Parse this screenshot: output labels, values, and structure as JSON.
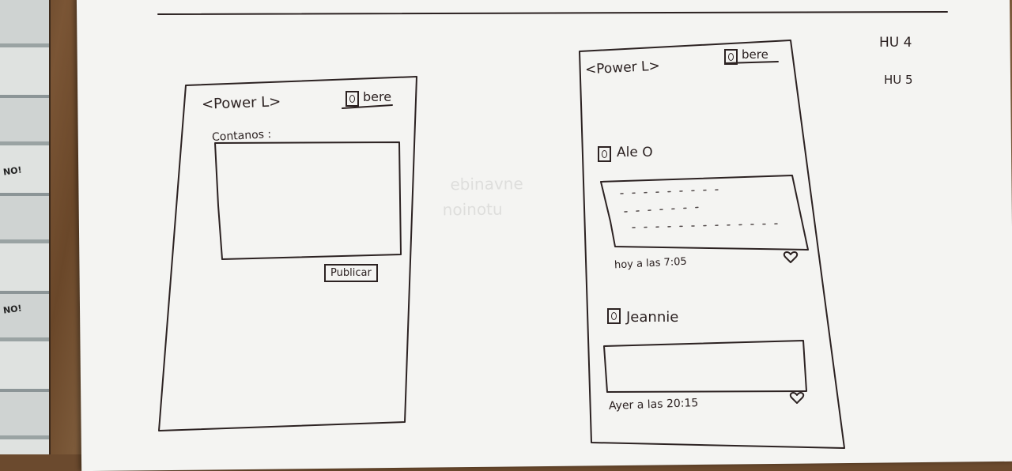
{
  "hu_labels": [
    "HU 4",
    "HU 5"
  ],
  "screen1": {
    "app_title": "<Power L>",
    "user_name": "bere",
    "prompt_label": "Contanos :",
    "publish_button": "Publicar"
  },
  "screen2": {
    "app_title": "<Power L>",
    "user_name": "bere",
    "posts": [
      {
        "author": "Ale O",
        "timestamp": "hoy a las 7:05"
      },
      {
        "author": "Jeannie",
        "timestamp": "Ayer a las 20:15"
      }
    ]
  },
  "colors": {
    "ink": "#2c2222",
    "paper": "#f4f4f2",
    "desk": "#6b4a2e"
  }
}
